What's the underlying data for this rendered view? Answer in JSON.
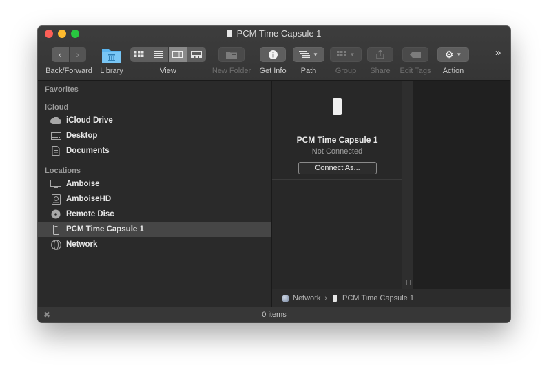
{
  "window": {
    "title": "PCM Time Capsule 1"
  },
  "toolbar": {
    "back_forward_label": "Back/Forward",
    "library_label": "Library",
    "view_label": "View",
    "new_folder_label": "New Folder",
    "get_info_label": "Get Info",
    "path_label": "Path",
    "group_label": "Group",
    "share_label": "Share",
    "edit_tags_label": "Edit Tags",
    "action_label": "Action",
    "overflow": "»"
  },
  "sidebar": {
    "favorites_header": "Favorites",
    "icloud_header": "iCloud",
    "icloud_items": [
      {
        "label": "iCloud Drive",
        "icon": "cloud-icon"
      },
      {
        "label": "Desktop",
        "icon": "desktop-icon"
      },
      {
        "label": "Documents",
        "icon": "documents-icon"
      }
    ],
    "locations_header": "Locations",
    "location_items": [
      {
        "label": "Amboise",
        "icon": "computer-icon"
      },
      {
        "label": "AmboiseHD",
        "icon": "hard-disk-icon"
      },
      {
        "label": "Remote Disc",
        "icon": "disc-icon"
      },
      {
        "label": "PCM Time Capsule 1",
        "icon": "time-capsule-icon",
        "selected": true
      },
      {
        "label": "Network",
        "icon": "network-globe-icon"
      }
    ]
  },
  "preview": {
    "name": "PCM Time Capsule 1",
    "status": "Not Connected",
    "connect_button": "Connect As..."
  },
  "pathbar": {
    "items": [
      "Network",
      "PCM Time Capsule 1"
    ]
  },
  "statusbar": {
    "text": "0 items"
  },
  "colors": {
    "close": "#fd5f57",
    "minimize": "#febb2e",
    "maximize": "#28c840",
    "selection": "#464646",
    "library_folder": "#5bb5ef"
  }
}
